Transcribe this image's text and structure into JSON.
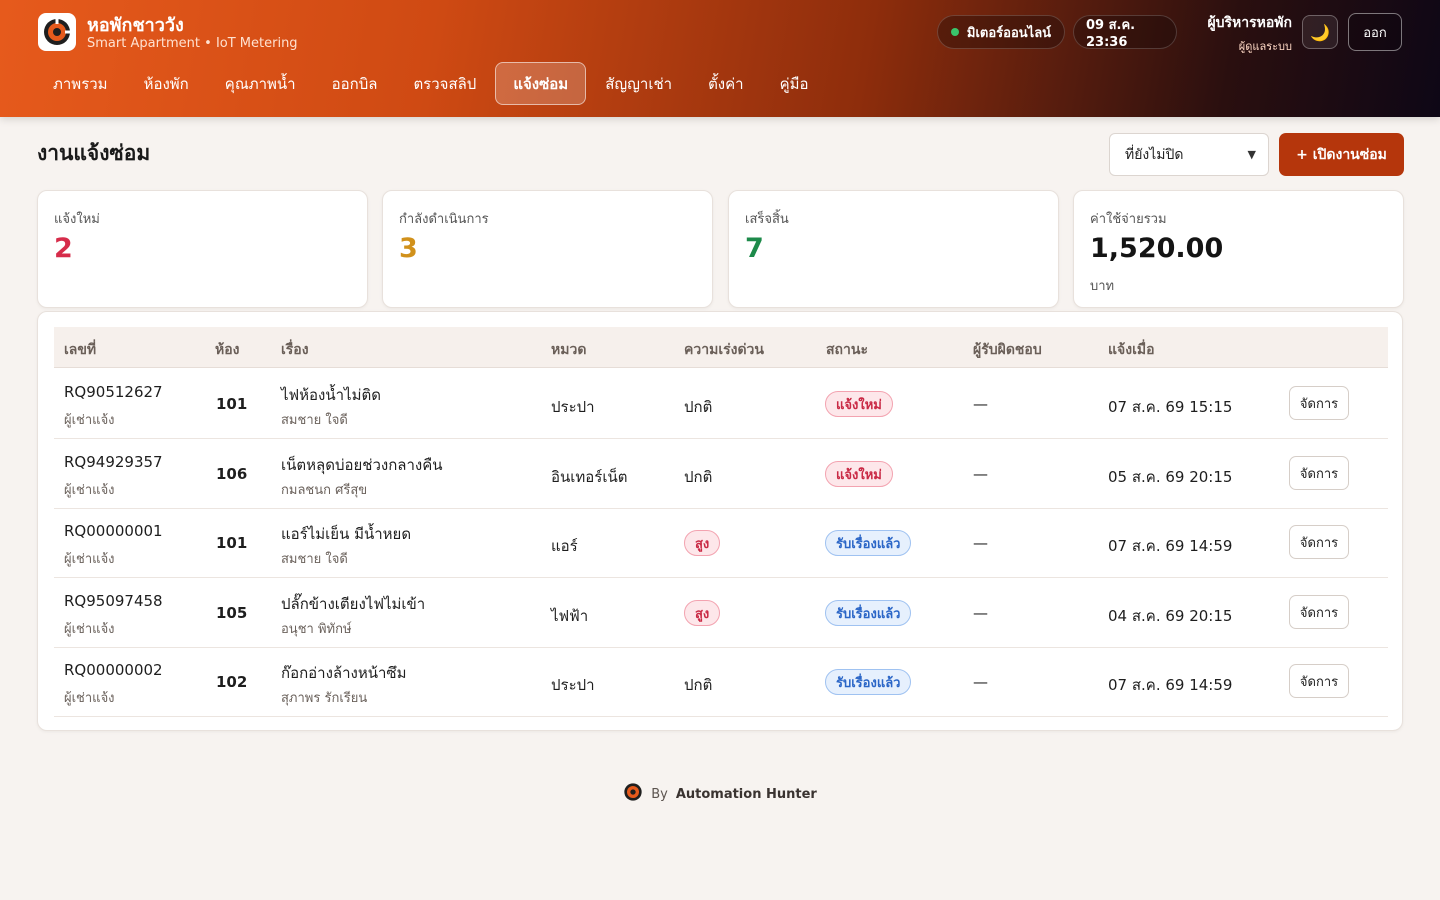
{
  "header": {
    "brand_title": "หอพักชาววัง",
    "brand_subtitle": "Smart Apartment • IoT Metering",
    "meter_status": "มิเตอร์ออนไลน์",
    "datetime": "09 ส.ค. 23:36",
    "user_name": "ผู้บริหารหอพัก",
    "user_role": "ผู้ดูแลระบบ",
    "theme_icon": "moon-icon",
    "logout_label": "ออก"
  },
  "nav": {
    "items": [
      {
        "label": "ภาพรวม"
      },
      {
        "label": "ห้องพัก"
      },
      {
        "label": "คุณภาพน้ำ"
      },
      {
        "label": "ออกบิล"
      },
      {
        "label": "ตรวจสลิป"
      },
      {
        "label": "แจ้งซ่อม"
      },
      {
        "label": "สัญญาเช่า"
      },
      {
        "label": "ตั้งค่า"
      },
      {
        "label": "คู่มือ"
      }
    ],
    "active_index": 5
  },
  "page": {
    "title": "งานแจ้งซ่อม",
    "filter_value": "ที่ยังไม่ปิด",
    "new_button_label": "+ เปิดงานซ่อม"
  },
  "stats": {
    "new": {
      "label": "แจ้งใหม่",
      "value": "2",
      "color": "#d62c4a"
    },
    "in_progress": {
      "label": "กำลังดำเนินการ",
      "value": "3",
      "color": "#d1911b"
    },
    "done": {
      "label": "เสร็จสิ้น",
      "value": "7",
      "color": "#1d8a4a"
    },
    "cost": {
      "label": "ค่าใช้จ่ายรวม",
      "value": "1,520.00",
      "unit": "บาท"
    }
  },
  "table": {
    "headers": {
      "id": "เลขที่",
      "room": "ห้อง",
      "subject": "เรื่อง",
      "category": "หมวด",
      "urgency": "ความเร่งด่วน",
      "status": "สถานะ",
      "assignee": "ผู้รับผิดชอบ",
      "reported_at": "แจ้งเมื่อ"
    },
    "manage_label": "จัดการ",
    "rows": [
      {
        "id": "RQ90512627",
        "source": "ผู้เช่าแจ้ง",
        "room": "101",
        "subject": "ไฟห้องน้ำไม่ติด",
        "tenant": "สมชาย ใจดี",
        "category": "ประปา",
        "urgency": "ปกติ",
        "status": "แจ้งใหม่",
        "assignee": "—",
        "reported_at": "07 ส.ค. 69 15:15"
      },
      {
        "id": "RQ94929357",
        "source": "ผู้เช่าแจ้ง",
        "room": "106",
        "subject": "เน็ตหลุดบ่อยช่วงกลางคืน",
        "tenant": "กมลชนก ศรีสุข",
        "category": "อินเทอร์เน็ต",
        "urgency": "ปกติ",
        "status": "แจ้งใหม่",
        "assignee": "—",
        "reported_at": "05 ส.ค. 69 20:15"
      },
      {
        "id": "RQ00000001",
        "source": "ผู้เช่าแจ้ง",
        "room": "101",
        "subject": "แอร์ไม่เย็น มีน้ำหยด",
        "tenant": "สมชาย ใจดี",
        "category": "แอร์",
        "urgency": "สูง",
        "status": "รับเรื่องแล้ว",
        "assignee": "—",
        "reported_at": "07 ส.ค. 69 14:59"
      },
      {
        "id": "RQ95097458",
        "source": "ผู้เช่าแจ้ง",
        "room": "105",
        "subject": "ปลั๊กข้างเตียงไฟไม่เข้า",
        "tenant": "อนุชา พิทักษ์",
        "category": "ไฟฟ้า",
        "urgency": "สูง",
        "status": "รับเรื่องแล้ว",
        "assignee": "—",
        "reported_at": "04 ส.ค. 69 20:15"
      },
      {
        "id": "RQ00000002",
        "source": "ผู้เช่าแจ้ง",
        "room": "102",
        "subject": "ก๊อกอ่างล้างหน้าซึม",
        "tenant": "สุภาพร รักเรียน",
        "category": "ประปา",
        "urgency": "ปกติ",
        "status": "รับเรื่องแล้ว",
        "assignee": "—",
        "reported_at": "07 ส.ค. 69 14:59"
      }
    ]
  },
  "footer": {
    "prefix": "By",
    "author": "Automation Hunter"
  },
  "colors": {
    "accent": "#b5360c",
    "header_start": "#e65a1c",
    "header_end": "#0e0716"
  }
}
